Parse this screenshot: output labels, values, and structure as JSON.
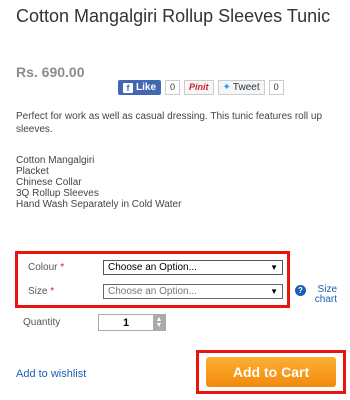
{
  "product": {
    "title": "Cotton Mangalgiri Rollup Sleeves Tunic",
    "price": "Rs. 690.00",
    "description": "Perfect for work as well as casual dressing. This tunic features roll up sleeves.",
    "features": [
      "Cotton Mangalgiri",
      "Placket",
      "Chinese Collar",
      "3Q Rollup Sleeves",
      "Hand Wash Separately in Cold Water"
    ]
  },
  "social": {
    "like_label": "Like",
    "like_count": "0",
    "pin_label": "Pinit",
    "pin_count": "",
    "tweet_label": "Tweet",
    "tweet_count": "0"
  },
  "options": {
    "colour_label": "Colour",
    "colour_value": "Choose an Option...",
    "size_label": "Size",
    "size_value": "Choose an Option...",
    "required_mark": "*",
    "size_chart_label": "Size chart"
  },
  "quantity": {
    "label": "Quantity",
    "value": "1"
  },
  "actions": {
    "wishlist_label": "Add to wishlist",
    "cart_label": "Add to Cart"
  },
  "colors": {
    "highlight": "#e8140e",
    "cart_button": "#f7a11f",
    "link": "#1b5fb4"
  }
}
